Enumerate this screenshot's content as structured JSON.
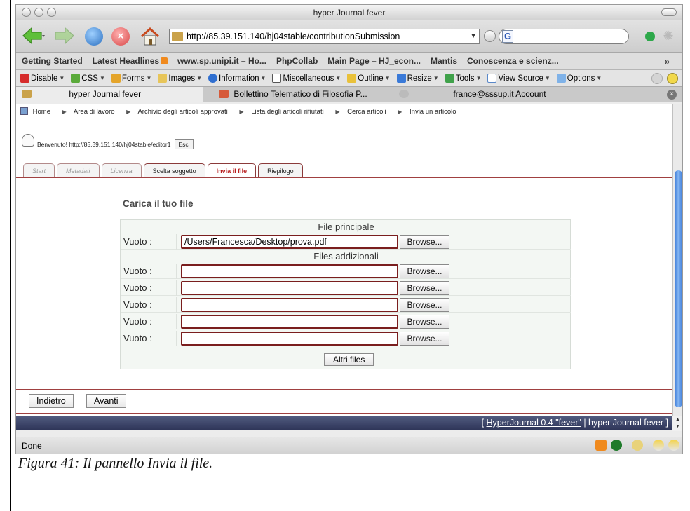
{
  "window": {
    "title": "hyper Journal fever"
  },
  "toolbar": {
    "url": "http://85.39.151.140/hj04stable/contributionSubmission",
    "search_engine_letter": "G"
  },
  "bookmarks": [
    "Getting Started",
    "Latest Headlines",
    "www.sp.unipi.it – Ho...",
    "PhpCollab",
    "Main Page – HJ_econ...",
    "Mantis",
    "Conoscenza e scienz..."
  ],
  "bookmarks_more": "»",
  "devbar": [
    "Disable",
    "CSS",
    "Forms",
    "Images",
    "Information",
    "Miscellaneous",
    "Outline",
    "Resize",
    "Tools",
    "View Source",
    "Options"
  ],
  "tabs": [
    {
      "label": "hyper Journal fever"
    },
    {
      "label": "Bollettino Telematico di Filosofia P..."
    },
    {
      "label": "france@sssup.it Account"
    }
  ],
  "breadcrumb": {
    "home": "Home",
    "items": [
      "Area di lavoro",
      "Archivio degli articoli approvati",
      "Lista degli articoli rifiutati",
      "Cerca articoli",
      "Invia un articolo"
    ]
  },
  "welcome": {
    "text": "Benvenuto! http://85.39.151.140/hj04stable/editor1",
    "logout": "Esci"
  },
  "steps": [
    {
      "label": "Start",
      "state": "disabled"
    },
    {
      "label": "Metadati",
      "state": "disabled"
    },
    {
      "label": "Licenza",
      "state": "disabled"
    },
    {
      "label": "Scelta soggetto",
      "state": "enabled"
    },
    {
      "label": "Invia il file",
      "state": "current"
    },
    {
      "label": "Riepilogo",
      "state": "enabled"
    }
  ],
  "form": {
    "title": "Carica il tuo file",
    "main_header": "File principale",
    "additional_header": "Files addizionali",
    "empty_label": "Vuoto :",
    "main_file_value": "/Users/Francesca/Desktop/prova.pdf",
    "browse_label": "Browse...",
    "more_files_label": "Altri files",
    "additional_values": [
      "",
      "",
      "",
      "",
      ""
    ]
  },
  "nav_buttons": {
    "back": "Indietro",
    "next": "Avanti"
  },
  "footer": {
    "link": "HyperJournal 0.4 \"fever\"",
    "rest": " | hyper Journal fever ]",
    "prefix": "[ "
  },
  "status": {
    "text": "Done"
  },
  "caption": "Figura 41: Il pannello Invia il file.",
  "colors": {
    "accent_red": "#b81e1e",
    "footer_bg": "#3a4266",
    "scroll_thumb": "#4a86dc"
  }
}
